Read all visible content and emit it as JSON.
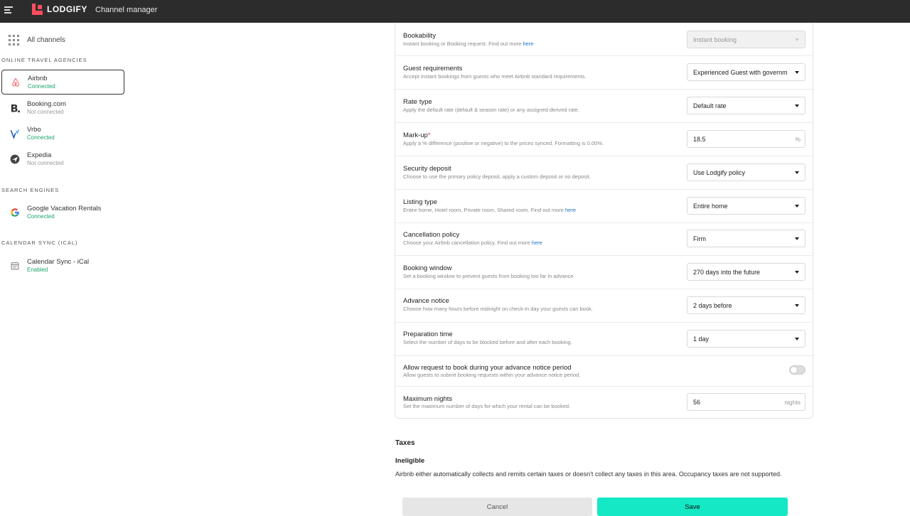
{
  "app": {
    "brand": "LODGIFY",
    "title": "Channel manager"
  },
  "sidebar": {
    "all_channels_label": "All channels",
    "sections": {
      "ota": "ONLINE TRAVEL AGENCIES",
      "search": "SEARCH ENGINES",
      "ical": "CALENDAR SYNC (ICAL)"
    },
    "channels": [
      {
        "name": "Airbnb",
        "status": "Connected",
        "state": "on",
        "icon": "airbnb-icon"
      },
      {
        "name": "Booking.com",
        "status": "Not connected",
        "state": "off",
        "icon": "booking-icon"
      },
      {
        "name": "Vrbo",
        "status": "Connected",
        "state": "on",
        "icon": "vrbo-icon"
      },
      {
        "name": "Expedia",
        "status": "Not connected",
        "state": "off",
        "icon": "expedia-icon"
      },
      {
        "name": "Google Vacation Rentals",
        "status": "Connected",
        "state": "on",
        "icon": "google-icon"
      },
      {
        "name": "Calendar Sync - iCal",
        "status": "Enabled",
        "state": "on",
        "icon": "calendar-icon"
      }
    ]
  },
  "settings": {
    "link_text": "here",
    "rows": [
      {
        "title": "Bookability",
        "desc": "Instant booking or Booking request. Find out more ",
        "value": "Instant booking"
      },
      {
        "title": "Guest requirements",
        "desc": "Accept instant bookings from guests who meet Airbnb standard requirements.",
        "value": "Experienced Guest with governm"
      },
      {
        "title": "Rate type",
        "desc": "Apply the default rate (default & season rate) or any assigned derived rate.",
        "value": "Default rate"
      },
      {
        "title": "Mark-up",
        "required_mark": "*",
        "desc": "Apply a % difference (positive or negative) to the prices synced. Formatting is 0.00%.",
        "value": "18.5",
        "suffix": "%"
      },
      {
        "title": "Security deposit",
        "desc": "Choose to use the primary policy deposit, apply a custom deposit or no deposit.",
        "value": "Use Lodgify policy"
      },
      {
        "title": "Listing type",
        "desc": "Entire home, Hotel room, Private room, Shared room. Find out more ",
        "value": "Entire home"
      },
      {
        "title": "Cancellation policy",
        "desc": "Choose your Airbnb cancellation policy. Find out more ",
        "value": "Firm"
      },
      {
        "title": "Booking window",
        "desc": "Set a booking window to prevent guests from booking too far in advance",
        "value": "270 days into the future"
      },
      {
        "title": "Advance notice",
        "desc": "Choose how many hours before midnight on check-in day your guests can book.",
        "value": "2 days before"
      },
      {
        "title": "Preparation time",
        "desc": "Select the number of days to be blocked before and after each booking.",
        "value": "1 day"
      },
      {
        "title": "Allow request to book during your advance notice period",
        "desc": "Allow guests to submit booking requests within your advance notice period.",
        "toggle": false
      },
      {
        "title": "Maximum nights",
        "desc": "Set the maximum number of days for which your rental can be booked.",
        "value": "56",
        "suffix": "nights"
      }
    ]
  },
  "taxes": {
    "title": "Taxes",
    "status": "Ineligible",
    "description": "Airbnb either automatically collects and remits certain taxes or doesn't collect any taxes in this area. Occupancy taxes are not supported."
  },
  "actions": {
    "cancel": "Cancel",
    "save": "Save"
  },
  "colors": {
    "accent": "#14e8c4",
    "connected": "#1aa56b",
    "brand": "#ff4d5e"
  }
}
